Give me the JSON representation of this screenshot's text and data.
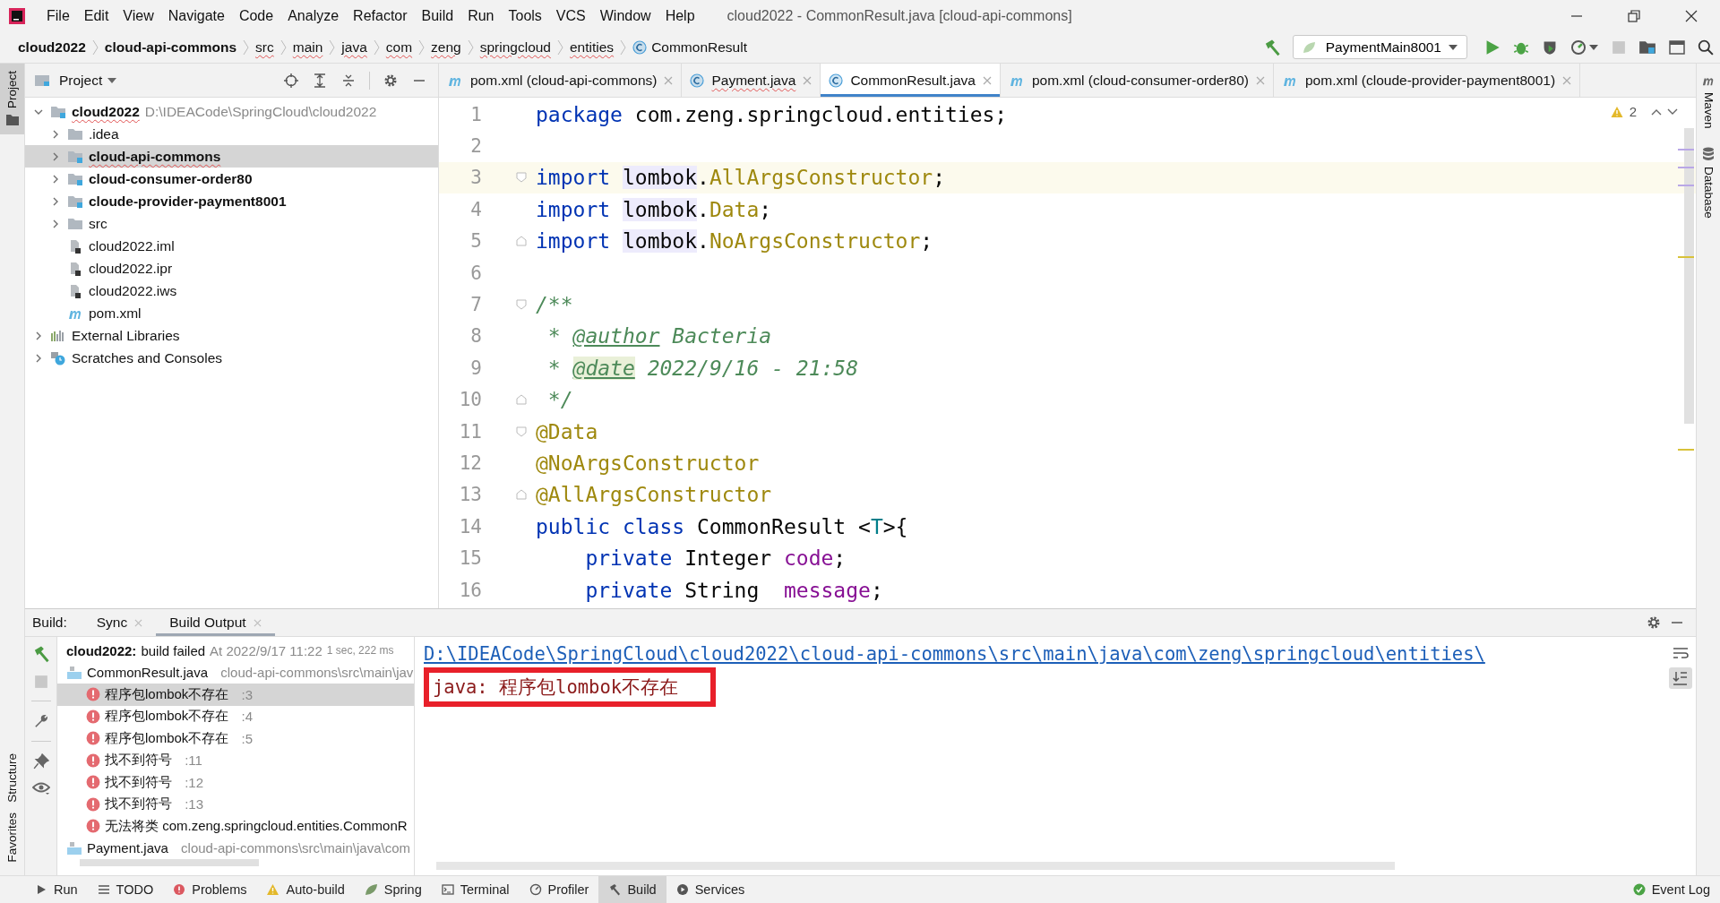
{
  "window": {
    "title": "cloud2022 - CommonResult.java [cloud-api-commons]"
  },
  "menu": [
    "File",
    "Edit",
    "View",
    "Navigate",
    "Code",
    "Analyze",
    "Refactor",
    "Build",
    "Run",
    "Tools",
    "VCS",
    "Window",
    "Help"
  ],
  "breadcrumbs": [
    {
      "label": "cloud2022",
      "kind": "module",
      "error": false
    },
    {
      "label": "cloud-api-commons",
      "kind": "module",
      "error": false
    },
    {
      "label": "src",
      "kind": "folder",
      "error": true
    },
    {
      "label": "main",
      "kind": "folder",
      "error": true
    },
    {
      "label": "java",
      "kind": "folder",
      "error": true
    },
    {
      "label": "com",
      "kind": "folder",
      "error": true
    },
    {
      "label": "zeng",
      "kind": "folder",
      "error": true
    },
    {
      "label": "springcloud",
      "kind": "folder",
      "error": true
    },
    {
      "label": "entities",
      "kind": "folder",
      "error": true
    },
    {
      "label": "CommonResult",
      "kind": "class",
      "error": false
    }
  ],
  "run_config": {
    "label": "PaymentMain8001"
  },
  "left_stripe": {
    "top": [
      "Project"
    ],
    "bottom": [
      "Structure",
      "Favorites"
    ]
  },
  "right_stripe": [
    "Maven",
    "Database"
  ],
  "project": {
    "title": "Project",
    "items": [
      {
        "name": "cloud2022",
        "path": "D:\\IDEACode\\SpringCloud\\cloud2022",
        "kind": "module",
        "bold": true,
        "expanded": true,
        "selected": false,
        "children": [
          {
            "name": ".idea",
            "kind": "folder",
            "bold": false,
            "expanded": false,
            "selected": false
          },
          {
            "name": "cloud-api-commons",
            "kind": "module",
            "bold": true,
            "expanded": false,
            "selected": true
          },
          {
            "name": "cloud-consumer-order80",
            "kind": "module",
            "bold": true,
            "expanded": false,
            "selected": false
          },
          {
            "name": "cloude-provider-payment8001",
            "kind": "module",
            "bold": true,
            "expanded": false,
            "selected": false
          },
          {
            "name": "src",
            "kind": "folder",
            "bold": false,
            "expanded": false,
            "selected": false
          },
          {
            "name": "cloud2022.iml",
            "kind": "file",
            "bold": false,
            "selected": false
          },
          {
            "name": "cloud2022.ipr",
            "kind": "file",
            "bold": false,
            "selected": false
          },
          {
            "name": "cloud2022.iws",
            "kind": "file",
            "bold": false,
            "selected": false
          },
          {
            "name": "pom.xml",
            "kind": "maven",
            "bold": false,
            "selected": false
          }
        ]
      },
      {
        "name": "External Libraries",
        "kind": "libraries",
        "bold": false,
        "expanded": false,
        "selected": false
      },
      {
        "name": "Scratches and Consoles",
        "kind": "scratches",
        "bold": false,
        "expanded": false,
        "selected": false
      }
    ]
  },
  "editor": {
    "tabs": [
      {
        "label": "pom.xml (cloud-api-commons)",
        "kind": "maven",
        "error": false,
        "selected": false
      },
      {
        "label": "Payment.java",
        "kind": "class",
        "error": true,
        "selected": false
      },
      {
        "label": "CommonResult.java",
        "kind": "class",
        "error": false,
        "selected": true
      },
      {
        "label": "pom.xml (cloud-consumer-order80)",
        "kind": "maven",
        "error": false,
        "selected": false
      },
      {
        "label": "pom.xml (cloude-provider-payment8001)",
        "kind": "maven",
        "error": false,
        "selected": false
      }
    ],
    "warnings": "2",
    "lines": [
      {
        "number": "1",
        "kind": "plain",
        "current": false,
        "tokens": [
          {
            "text": "package",
            "kind": "keyword"
          },
          {
            "text": " com.zeng.springcloud.entities;",
            "kind": "plain"
          }
        ]
      },
      {
        "number": "2",
        "kind": "plain",
        "current": false
      },
      {
        "number": "3",
        "kind": "fold-start",
        "current": true,
        "tokens": [
          {
            "text": "import ",
            "kind": "keyword"
          },
          {
            "text": "lombok",
            "kind": "ident"
          },
          {
            "text": ".",
            "kind": "plain"
          },
          {
            "text": "AllArgsConstructor",
            "kind": "unresolved"
          },
          {
            "text": ";",
            "kind": "plain"
          }
        ]
      },
      {
        "number": "4",
        "kind": "plain",
        "current": false,
        "tokens": [
          {
            "text": "import ",
            "kind": "keyword"
          },
          {
            "text": "lombok",
            "kind": "ident"
          },
          {
            "text": ".",
            "kind": "plain"
          },
          {
            "text": "Data",
            "kind": "unresolved"
          },
          {
            "text": ";",
            "kind": "plain"
          }
        ]
      },
      {
        "number": "5",
        "kind": "fold-end",
        "current": false,
        "tokens": [
          {
            "text": "import ",
            "kind": "keyword"
          },
          {
            "text": "lombok",
            "kind": "ident"
          },
          {
            "text": ".",
            "kind": "plain"
          },
          {
            "text": "NoArgsConstructor",
            "kind": "unresolved"
          },
          {
            "text": ";",
            "kind": "plain"
          }
        ]
      },
      {
        "number": "6",
        "kind": "plain",
        "current": false
      },
      {
        "number": "7",
        "kind": "fold-start",
        "current": false,
        "tokens": [
          {
            "text": "/**",
            "kind": "comment"
          }
        ]
      },
      {
        "number": "8",
        "kind": "plain",
        "current": false,
        "tokens": [
          {
            "text": " * ",
            "kind": "comment"
          },
          {
            "text": "@author",
            "kind": "doctag"
          },
          {
            "text": " Bacteria",
            "kind": "comment"
          }
        ]
      },
      {
        "number": "9",
        "kind": "plain",
        "current": false,
        "tokens": [
          {
            "text": " * ",
            "kind": "comment"
          },
          {
            "text": "@date",
            "kind": "doctag-hl"
          },
          {
            "text": " 2022/9/16 - 21:58",
            "kind": "comment"
          }
        ]
      },
      {
        "number": "10",
        "kind": "fold-end",
        "current": false,
        "tokens": [
          {
            "text": " */",
            "kind": "comment"
          }
        ]
      },
      {
        "number": "11",
        "kind": "fold-start",
        "current": false,
        "tokens": [
          {
            "text": "@Data",
            "kind": "annotation"
          }
        ]
      },
      {
        "number": "12",
        "kind": "plain",
        "current": false,
        "tokens": [
          {
            "text": "@NoArgsConstructor",
            "kind": "annotation"
          }
        ]
      },
      {
        "number": "13",
        "kind": "fold-end",
        "current": false,
        "tokens": [
          {
            "text": "@AllArgsConstructor",
            "kind": "annotation"
          }
        ]
      },
      {
        "number": "14",
        "kind": "plain",
        "current": false,
        "tokens": [
          {
            "text": "public class",
            "kind": "keyword"
          },
          {
            "text": " CommonResult <",
            "kind": "plain"
          },
          {
            "text": "T",
            "kind": "typeparam"
          },
          {
            "text": ">{",
            "kind": "plain"
          }
        ]
      },
      {
        "number": "15",
        "kind": "plain",
        "current": false,
        "tokens": [
          {
            "text": "    private",
            "kind": "keyword"
          },
          {
            "text": " Integer ",
            "kind": "plain"
          },
          {
            "text": "code",
            "kind": "field"
          },
          {
            "text": ";",
            "kind": "plain"
          }
        ]
      },
      {
        "number": "16",
        "kind": "plain",
        "current": false,
        "tokens": [
          {
            "text": "    private",
            "kind": "keyword"
          },
          {
            "text": " String  ",
            "kind": "plain"
          },
          {
            "text": "message",
            "kind": "field"
          },
          {
            "text": ";",
            "kind": "plain"
          }
        ]
      }
    ]
  },
  "build": {
    "label": "Build:",
    "tabs": [
      {
        "label": "Sync",
        "selected": false
      },
      {
        "label": "Build Output",
        "selected": true
      }
    ],
    "summary": {
      "project": "cloud2022:",
      "status": "build failed",
      "time": "At 2022/9/17 11:22",
      "duration": "1 sec, 222 ms"
    },
    "tree": [
      {
        "name": "CommonResult.java",
        "path": "cloud-api-commons\\src\\main\\jav",
        "selected": false,
        "children": [
          {
            "message": "程序包lombok不存在",
            "line": ":3",
            "selected": true
          },
          {
            "message": "程序包lombok不存在",
            "line": ":4",
            "selected": false
          },
          {
            "message": "程序包lombok不存在",
            "line": ":5",
            "selected": false
          },
          {
            "message": "找不到符号",
            "line": ":11",
            "selected": false
          },
          {
            "message": "找不到符号",
            "line": ":12",
            "selected": false
          },
          {
            "message": "找不到符号",
            "line": ":13",
            "selected": false
          },
          {
            "message": "无法将类 com.zeng.springcloud.entities.CommonR",
            "selected": false
          }
        ]
      },
      {
        "name": "Payment.java",
        "path": "cloud-api-commons\\src\\main\\java\\com",
        "selected": false
      }
    ],
    "console": {
      "link": "D:\\IDEACode\\SpringCloud\\cloud2022\\cloud-api-commons\\src\\main\\java\\com\\zeng\\springcloud\\entities\\",
      "message": "java: 程序包lombok不存在"
    }
  },
  "tool_buttons": [
    {
      "label": "Run",
      "kind": "run",
      "selected": false
    },
    {
      "label": "TODO",
      "kind": "todo",
      "selected": false
    },
    {
      "label": "Problems",
      "kind": "problems",
      "selected": false
    },
    {
      "label": "Auto-build",
      "kind": "warning",
      "selected": false
    },
    {
      "label": "Spring",
      "kind": "spring",
      "selected": false
    },
    {
      "label": "Terminal",
      "kind": "terminal",
      "selected": false
    },
    {
      "label": "Profiler",
      "kind": "profiler",
      "selected": false
    },
    {
      "label": "Build",
      "kind": "build",
      "selected": true
    },
    {
      "label": "Services",
      "kind": "services",
      "selected": false
    }
  ],
  "event_log": {
    "label": "Event Log"
  }
}
